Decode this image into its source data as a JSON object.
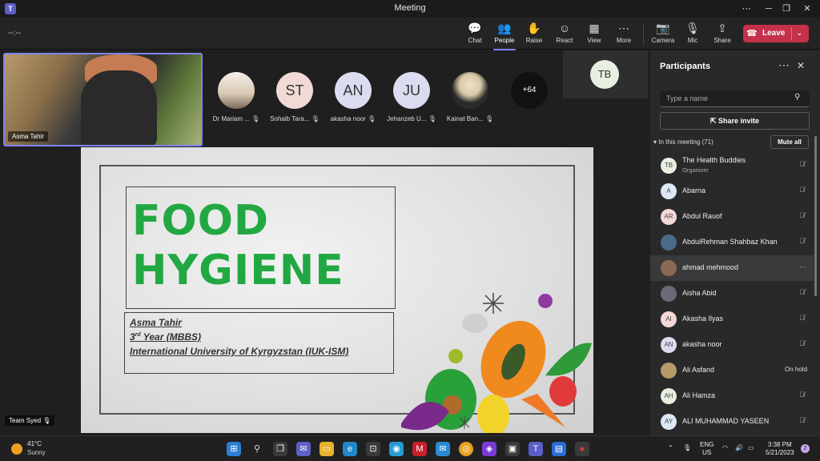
{
  "window": {
    "title": "Meeting",
    "app_icon_text": "T",
    "controls": [
      "⋯",
      "─",
      "❐",
      "✕"
    ]
  },
  "toolbar": {
    "timer": "--:--",
    "tools": [
      {
        "name": "chat",
        "label": "Chat",
        "icon": "💬"
      },
      {
        "name": "people",
        "label": "People",
        "icon": "👥",
        "active": true
      },
      {
        "name": "raise",
        "label": "Raise",
        "icon": "✋"
      },
      {
        "name": "react",
        "label": "React",
        "icon": "☺"
      },
      {
        "name": "view",
        "label": "View",
        "icon": "▦"
      },
      {
        "name": "more",
        "label": "More",
        "icon": "⋯"
      },
      {
        "name": "camera",
        "label": "Camera",
        "icon": "📷"
      },
      {
        "name": "mic",
        "label": "Mic",
        "icon": "🎙"
      },
      {
        "name": "share",
        "label": "Share",
        "icon": "⇪"
      }
    ],
    "leave_label": "Leave",
    "leave_icon": "☎",
    "leave_chevron": "⌄"
  },
  "stage": {
    "self_video_name": "Asma Tahir",
    "participants": [
      {
        "initials": "",
        "name": "Dr Mariam ...",
        "color": "#e9e1da",
        "photo": true
      },
      {
        "initials": "ST",
        "name": "Sohaib Tara...",
        "color": "#f1d9d6"
      },
      {
        "initials": "AN",
        "name": "akasha noor",
        "color": "#dcdcf1"
      },
      {
        "initials": "JU",
        "name": "Jehanzeb U...",
        "color": "#dcdcf1"
      },
      {
        "initials": "",
        "name": "Kainat Ban...",
        "color": "#d9c9a8",
        "photo": true
      }
    ],
    "overflow_count": "+64",
    "organizer_tile_initials": "TB",
    "presenter_tag": "Team Syed"
  },
  "slide": {
    "title_line1": "FOOD",
    "title_line2": "HYGIENE",
    "author": "Asma Tahir",
    "year_num": "3",
    "year_sup": "rd",
    "year_rest": " Year (MBBS)",
    "university": "International University of Kyrgyzstan (IUK-ISM)"
  },
  "panel": {
    "title": "Participants",
    "search_placeholder": "Type a name",
    "share_invite": "Share invite",
    "in_meeting": "In this meeting (71)",
    "mute_all": "Mute all",
    "people": [
      {
        "initials": "TB",
        "name": "The Health Buddies",
        "role": "Organizer",
        "color": "#e6efe0",
        "status": "muted"
      },
      {
        "initials": "A",
        "name": "Abarna",
        "color": "#dde8f7",
        "status": "muted"
      },
      {
        "initials": "AR",
        "name": "Abdul Rauof",
        "color": "#f4d8d8",
        "status": "muted"
      },
      {
        "initials": "",
        "name": "AbdulRehman Shahbaz Khan",
        "color": "#4a6a8a",
        "status": "muted"
      },
      {
        "initials": "",
        "name": "ahmad mehmood",
        "color": "#8a6a55",
        "status": "more",
        "highlight": true
      },
      {
        "initials": "",
        "name": "Aisha Abid",
        "color": "#6a6a7a",
        "status": "muted"
      },
      {
        "initials": "AI",
        "name": "Akasha Ilyas",
        "color": "#f4d8d8",
        "status": "muted"
      },
      {
        "initials": "AN",
        "name": "akasha noor",
        "color": "#dcdcf1",
        "status": "muted"
      },
      {
        "initials": "",
        "name": "Ali Asfand",
        "color": "#b59a6a",
        "status": "hold",
        "status_text": "On hold"
      },
      {
        "initials": "AH",
        "name": "Ali Hamza",
        "color": "#e6efe0",
        "status": "muted"
      },
      {
        "initials": "AY",
        "name": "ALI MUHAMMAD YASEEN",
        "color": "#dde8f7",
        "status": "muted"
      }
    ]
  },
  "taskbar": {
    "temperature": "41°C",
    "condition": "Sunny",
    "lang_line1": "ENG",
    "lang_line2": "US",
    "time": "3:38 PM",
    "date": "5/21/2023",
    "notification_count": "2"
  }
}
